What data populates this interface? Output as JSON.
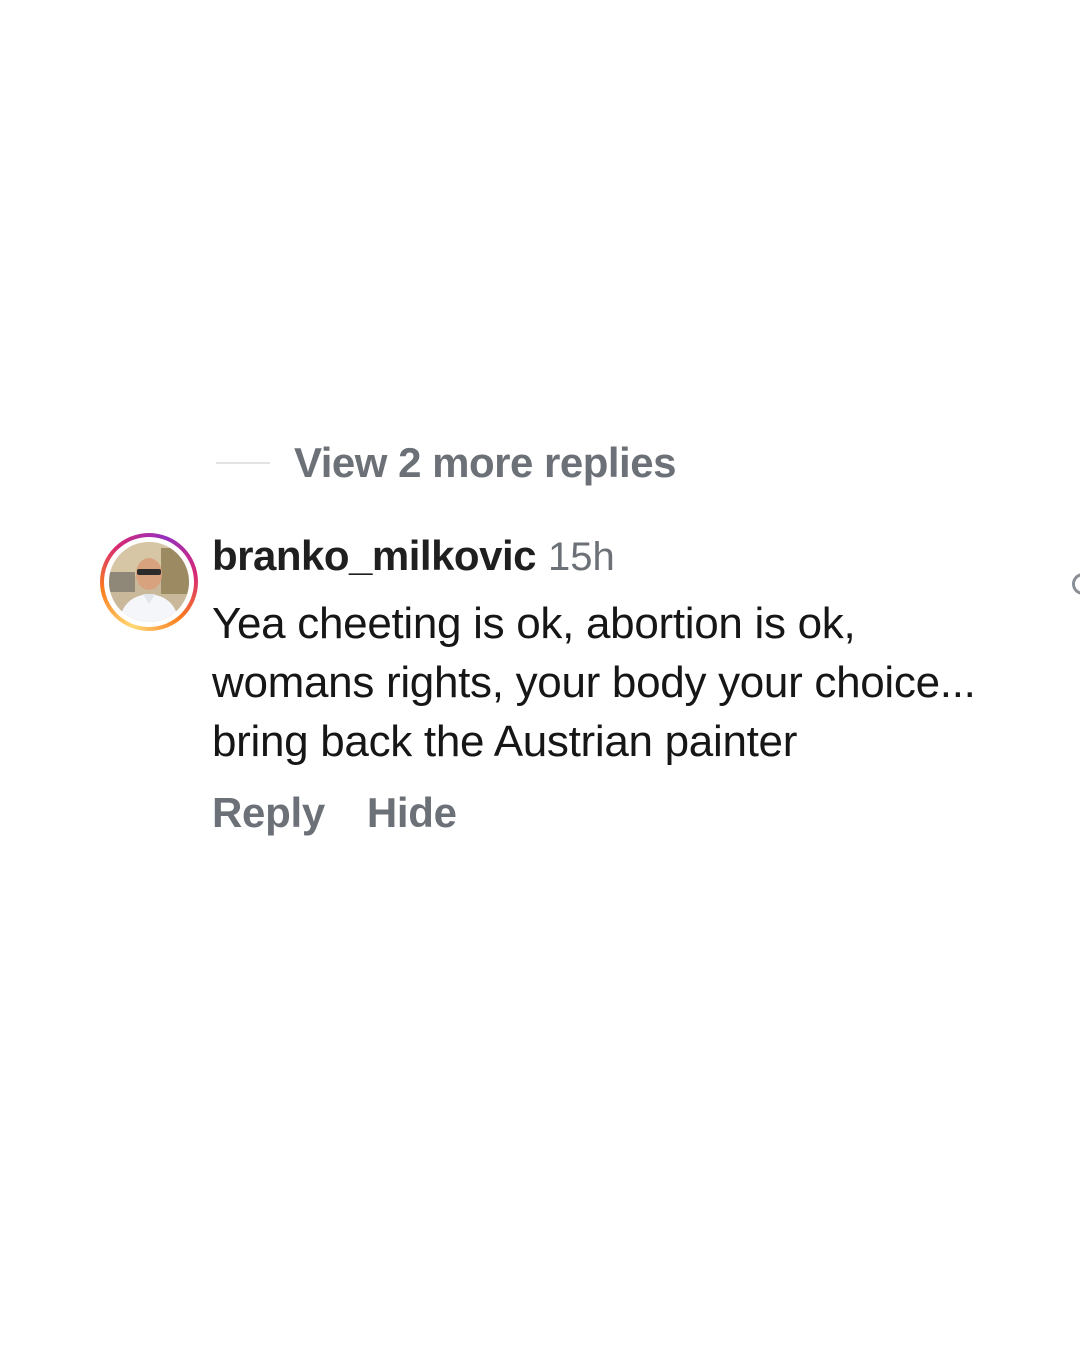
{
  "thread": {
    "view_more_replies": "View 2 more replies"
  },
  "comment": {
    "username": "branko_milkovic",
    "timestamp": "15h",
    "text": "Yea cheeting is ok, abortion is ok, womans rights, your body your choice... bring back the Austrian painter",
    "avatar_icon": "user-avatar-photo",
    "story_ring_colors": [
      "#feda75",
      "#fa7e1e",
      "#d62976",
      "#962fbf"
    ]
  },
  "actions": {
    "reply_label": "Reply",
    "hide_label": "Hide"
  },
  "like_icon": "heart-icon"
}
